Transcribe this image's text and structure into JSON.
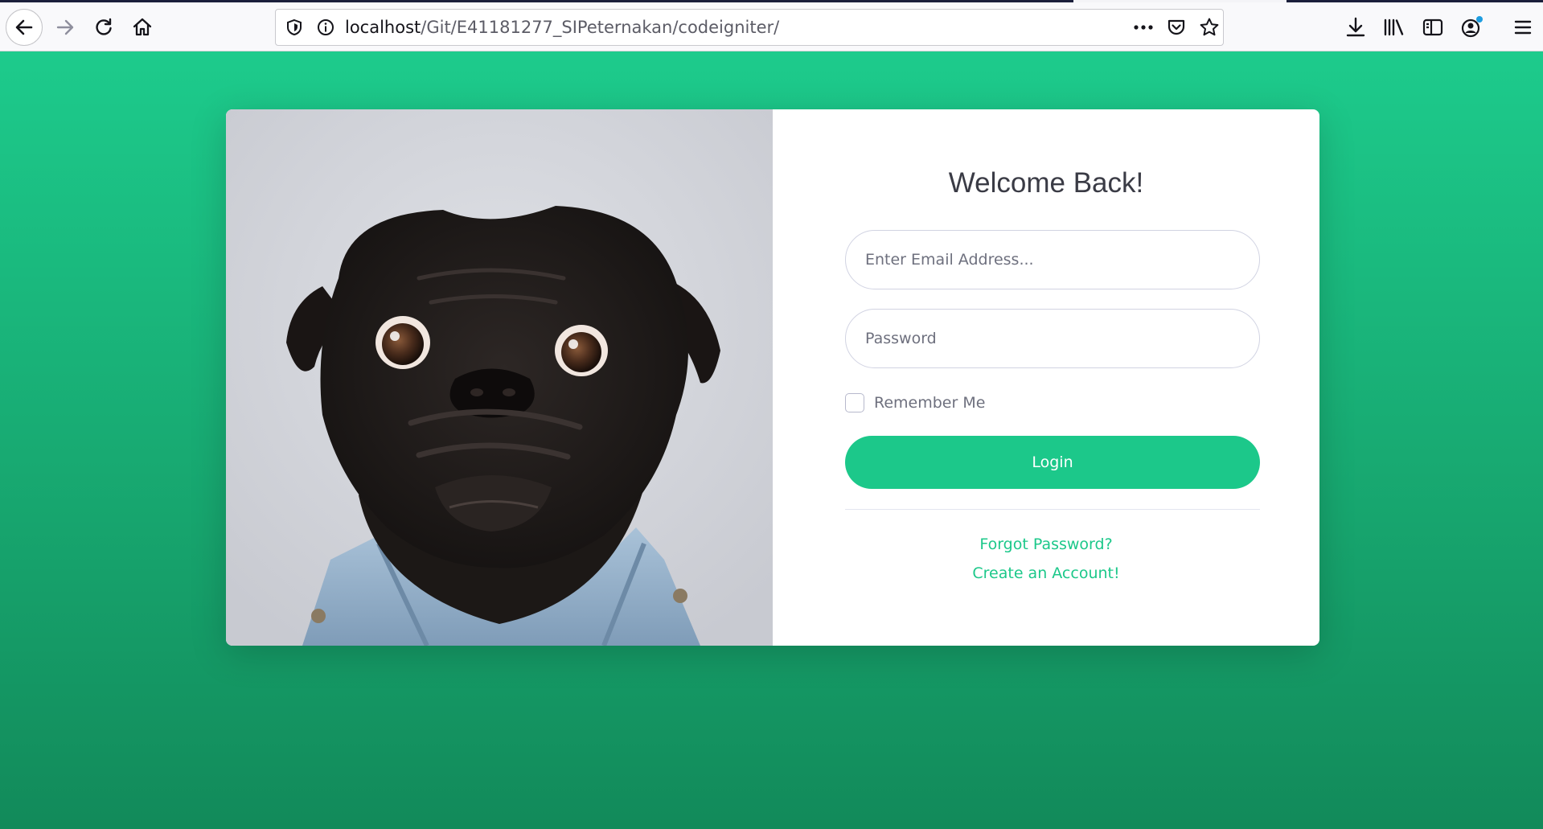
{
  "browser": {
    "url_host": "localhost",
    "url_path": "/Git/E41181277_SIPeternakan/codeigniter/",
    "icons": {
      "back": "back-arrow-icon",
      "forward": "forward-arrow-icon",
      "reload": "reload-icon",
      "home": "home-icon",
      "tracking": "shield-icon",
      "info": "info-icon",
      "page_actions": "more-dots-icon",
      "pocket": "pocket-icon",
      "bookmark": "star-icon",
      "downloads": "download-icon",
      "library": "library-icon",
      "sidebar": "sidebar-icon",
      "account": "account-icon",
      "menu": "hamburger-menu-icon"
    }
  },
  "login": {
    "title": "Welcome Back!",
    "email_placeholder": "Enter Email Address...",
    "password_placeholder": "Password",
    "remember_label": "Remember Me",
    "login_label": "Login",
    "forgot_label": "Forgot Password?",
    "create_label": "Create an Account!"
  },
  "colors": {
    "accent": "#1cc88a",
    "background_top": "#1dcb8c",
    "background_bottom": "#128a5a",
    "title_text": "#3a3b45",
    "muted_text": "#6e707e"
  }
}
